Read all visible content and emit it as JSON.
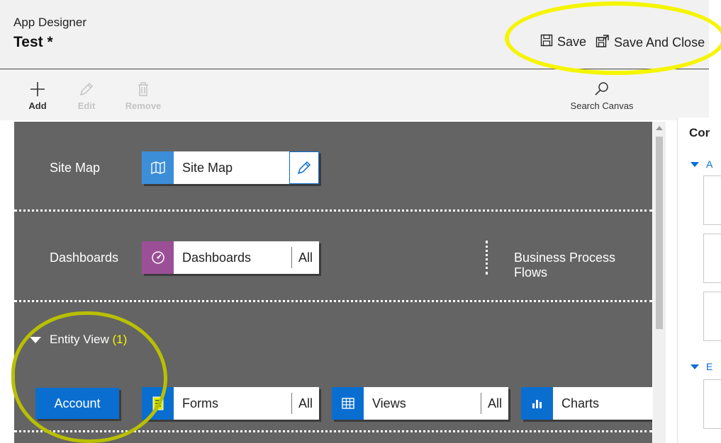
{
  "header": {
    "app_title": "App Designer",
    "doc_title": "Test *",
    "save_label": "Save",
    "save_close_label": "Save And Close"
  },
  "toolbar": {
    "add_label": "Add",
    "edit_label": "Edit",
    "remove_label": "Remove",
    "search_label": "Search Canvas"
  },
  "canvas": {
    "sitemap_row_label": "Site Map",
    "sitemap_tile_label": "Site Map",
    "dashboards_row_label": "Dashboards",
    "dashboards_tile_label": "Dashboards",
    "dashboards_all": "All",
    "bpf_label": "Business Process Flows",
    "entity_view_label": "Entity View",
    "entity_view_count": "(1)",
    "account_label": "Account",
    "forms_label": "Forms",
    "forms_all": "All",
    "views_label": "Views",
    "views_all": "All",
    "charts_label": "Charts"
  },
  "right_panel": {
    "title_fragment": "Cor",
    "section1_fragment": "A",
    "section2_fragment": "E"
  },
  "colors": {
    "canvas_bg": "#646464",
    "accent_blue": "#0a6ed1",
    "dashboard_purple": "#9b4f96",
    "entity_count_yellow": "#f3f300",
    "highlight_yellow": "#f5f500",
    "highlight_olive": "#b8c000"
  },
  "icons": {
    "save": "save-icon",
    "save_close": "save-close-icon",
    "add": "plus-icon",
    "edit": "pencil-icon",
    "remove": "trash-icon",
    "search": "magnifier-icon",
    "sitemap": "map-icon",
    "dashboard": "gauge-icon",
    "forms": "form-icon",
    "views": "grid-icon",
    "charts": "bar-chart-icon"
  }
}
